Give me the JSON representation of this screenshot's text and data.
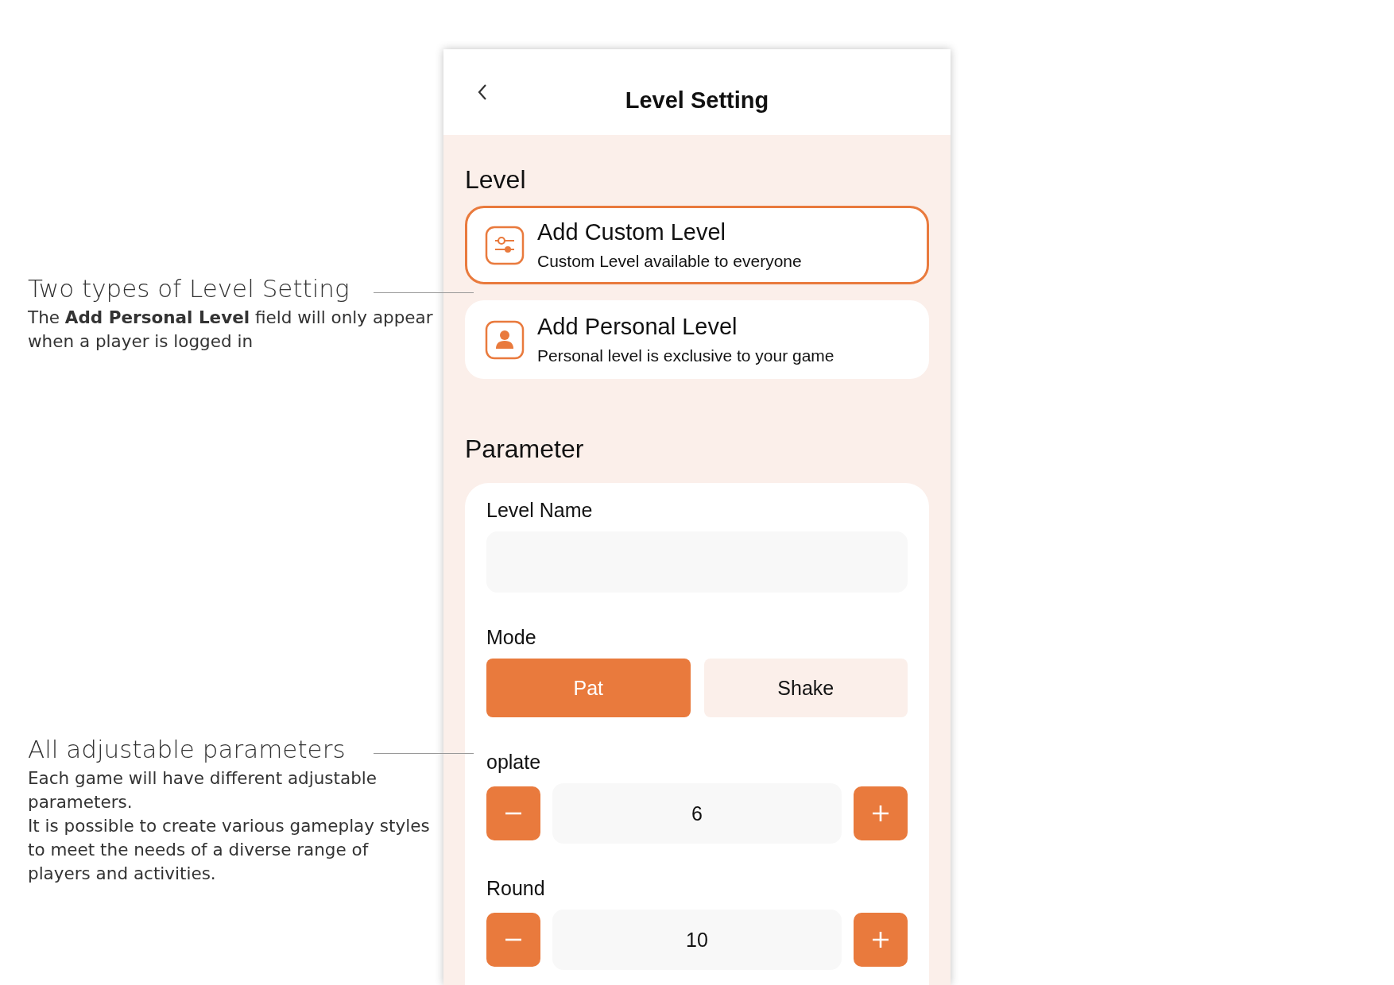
{
  "annotations": [
    {
      "title": "Two types of Level Setting",
      "paragraphs": [
        "The **Add Personal Level** field will only appear when a player is logged in"
      ]
    },
    {
      "title": "All adjustable parameters",
      "paragraphs": [
        "Each game will have different adjustable parameters.",
        "It is possible to create various gameplay styles to meet the needs of a diverse range of players and activities."
      ]
    }
  ],
  "screen": {
    "title": "Level Setting",
    "level_section": {
      "heading": "Level",
      "options": [
        {
          "kind": "custom",
          "title": "Add Custom Level",
          "subtitle": "Custom Level available to everyone",
          "selected": true
        },
        {
          "kind": "personal",
          "title": "Add Personal Level",
          "subtitle": "Personal level is exclusive to your game",
          "selected": false
        }
      ]
    },
    "parameter_section": {
      "heading": "Parameter",
      "fields": [
        {
          "kind": "text",
          "label": "Level Name"
        },
        {
          "kind": "segmented",
          "label": "Mode",
          "options": [
            {
              "label": "Pat",
              "selected": true
            },
            {
              "label": "Shake",
              "selected": false
            }
          ]
        },
        {
          "kind": "stepper",
          "label": "oplate",
          "value": "6"
        },
        {
          "kind": "stepper",
          "label": "Round",
          "value": "10"
        }
      ]
    }
  }
}
